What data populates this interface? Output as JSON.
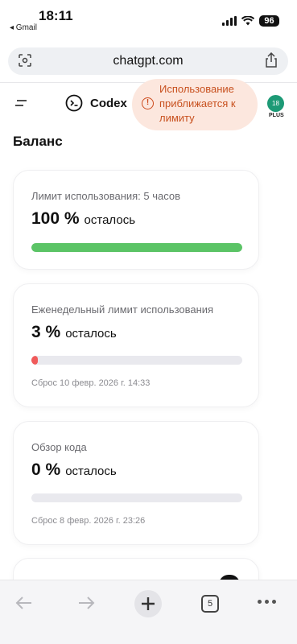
{
  "status_bar": {
    "time": "18:11",
    "back_app": "◂ Gmail",
    "battery": "96"
  },
  "browser": {
    "url": "chatgpt.com"
  },
  "header": {
    "brand": "Codex",
    "warning": "Использование приближается к лимиту",
    "avatar_text": "18",
    "plan": "PLUS"
  },
  "page": {
    "section_title": "Баланс"
  },
  "cards": [
    {
      "label": "Лимит использования: 5 часов",
      "value": "100 %",
      "unit": "осталось",
      "remaining_pct": 100,
      "bar_color": "#5bc466"
    },
    {
      "label": "Еженедельный лимит использования",
      "value": "3 %",
      "unit": "осталось",
      "remaining_pct": 3,
      "bar_color": "#f05a5a",
      "reset": "Сброс 10 февр. 2026 г. 14:33"
    },
    {
      "label": "Обзор кода",
      "value": "0 %",
      "unit": "осталось",
      "remaining_pct": 0,
      "bar_color": "#e9e9ee",
      "reset": "Сброс 8 февр. 2026 г. 23:26"
    }
  ],
  "toolbar": {
    "tab_count": "5"
  },
  "icons": [
    "signal-icon",
    "wifi-icon",
    "tabs-overview-icon",
    "share-icon",
    "menu-icon",
    "codex-icon",
    "warning-icon",
    "back-icon",
    "forward-icon",
    "plus-icon",
    "more-icon"
  ]
}
